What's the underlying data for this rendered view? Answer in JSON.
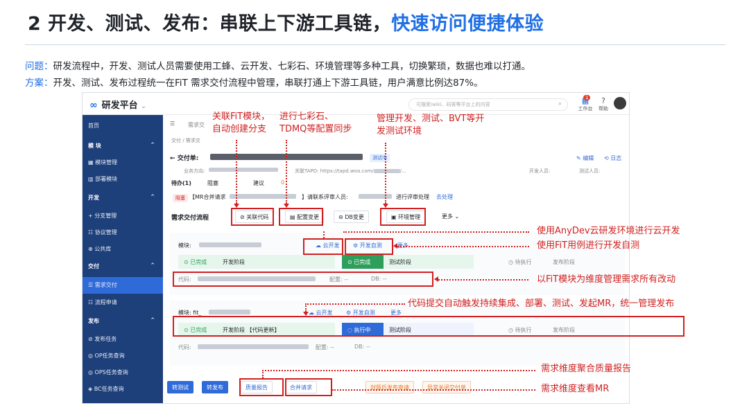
{
  "title": {
    "main": "2 开发、测试、发布：串联上下游工具链，",
    "highlight": "快速访问便捷体验"
  },
  "problem": {
    "key": "问题：",
    "text": "研发流程中，开发、测试人员需要使用工蜂、云开发、七彩石、环境管理等多种工具，切换繁琐，数据也难以打通。"
  },
  "solution": {
    "key": "方案：",
    "text": "开发、测试、发布过程统一在FiT 需求交付流程中管理，串联打通上下游工具链，用户满意比例达87%。"
  },
  "app": {
    "name": "研发平台",
    "search_placeholder": "可搜索iwiki、码客等平台上的内容",
    "workbench_label": "工作台",
    "workbench_badge": "1",
    "help_label": "帮助"
  },
  "sidebar": [
    {
      "label": "首页",
      "group": false
    },
    {
      "label": "模 块",
      "group": true
    },
    {
      "label": "模块管理",
      "group": false
    },
    {
      "label": "部署模块",
      "group": false
    },
    {
      "label": "开发",
      "group": true
    },
    {
      "label": "+ 分支管理",
      "group": false
    },
    {
      "label": "协议管理",
      "group": false
    },
    {
      "label": "公共库",
      "group": false
    },
    {
      "label": "交付",
      "group": true
    },
    {
      "label": "需求交付",
      "group": false
    },
    {
      "label": "流程申请",
      "group": false
    },
    {
      "label": "发布",
      "group": true
    },
    {
      "label": "发布任务",
      "group": false
    },
    {
      "label": "OP任务查询",
      "group": false
    },
    {
      "label": "OPS任务查询",
      "group": false
    },
    {
      "label": "BC任务查询",
      "group": false
    }
  ],
  "main": {
    "breadcrumb_tab": "需求交",
    "breadcrumb": "交付 / 需求交",
    "order_prefix": "交付单:",
    "test_tag": "测试中",
    "edit": "编辑",
    "log": "日志",
    "biz_dir": "业务方向:",
    "tapd": "关联TAPD: https://tapd.woa.com/",
    "tapd_tail": "/...",
    "dev_person": "开发人员:",
    "test_person": "测试人员:",
    "todo": "待办(1)",
    "blocked": "阻塞",
    "suggest": "建议",
    "suggest_count": "0",
    "blocked_tag": "阻塞",
    "mr_prefix": "【MR合并请求",
    "mr_mid": "】请联系评审人员:",
    "mr_review": "进行评审处理",
    "mr_go": "去处理",
    "flow_title": "需求交付流程",
    "flow_buttons": [
      "关联代码",
      "配置变更",
      "DB变更",
      "环境管理",
      "更多"
    ],
    "module_label": "模块:",
    "module2_label": "模块: fit_",
    "cloud_dev": "云开发",
    "dev_selftest": "开发自测",
    "more": "更多",
    "done": "已完成",
    "dev_stage": "开发阶段",
    "dev_stage_update": "开发阶段 【代码更新】",
    "test_stage": "测试阶段",
    "running": "执行中",
    "pending": "待执行",
    "release_stage": "发布阶段",
    "code": "代码:",
    "config": "配置: --",
    "db": "DB: --",
    "bottom_buttons": [
      "转测试",
      "转发布",
      "质量报告",
      "合并请求"
    ],
    "bottom_orange": [
      "封版后发布申请",
      "异常关闭交付单"
    ]
  },
  "annotations": {
    "a1": "关联FiT模块，",
    "a1b": "自动创建分支",
    "a2": "进行七彩石、",
    "a2b": "TDMQ等配置同步",
    "a3": "管理开发、测试、BVT等开",
    "a3b": "发测试环境",
    "r1": "使用AnyDev云研发环境进行云开发",
    "r2": "使用FiT用例进行开发自测",
    "r3": "以FiT模块为维度管理需求所有改动",
    "r4": "代码提交自动触发持续集成、部署、测试、发起MR，统一管理发布",
    "r5": "需求维度聚合质量报告",
    "r6": "需求维度查看MR"
  },
  "colors": {
    "accent": "#1f6fe6",
    "annotation": "#d11f1f",
    "sidebar": "#1d3f7a",
    "primary_button": "#2f6ad9"
  }
}
